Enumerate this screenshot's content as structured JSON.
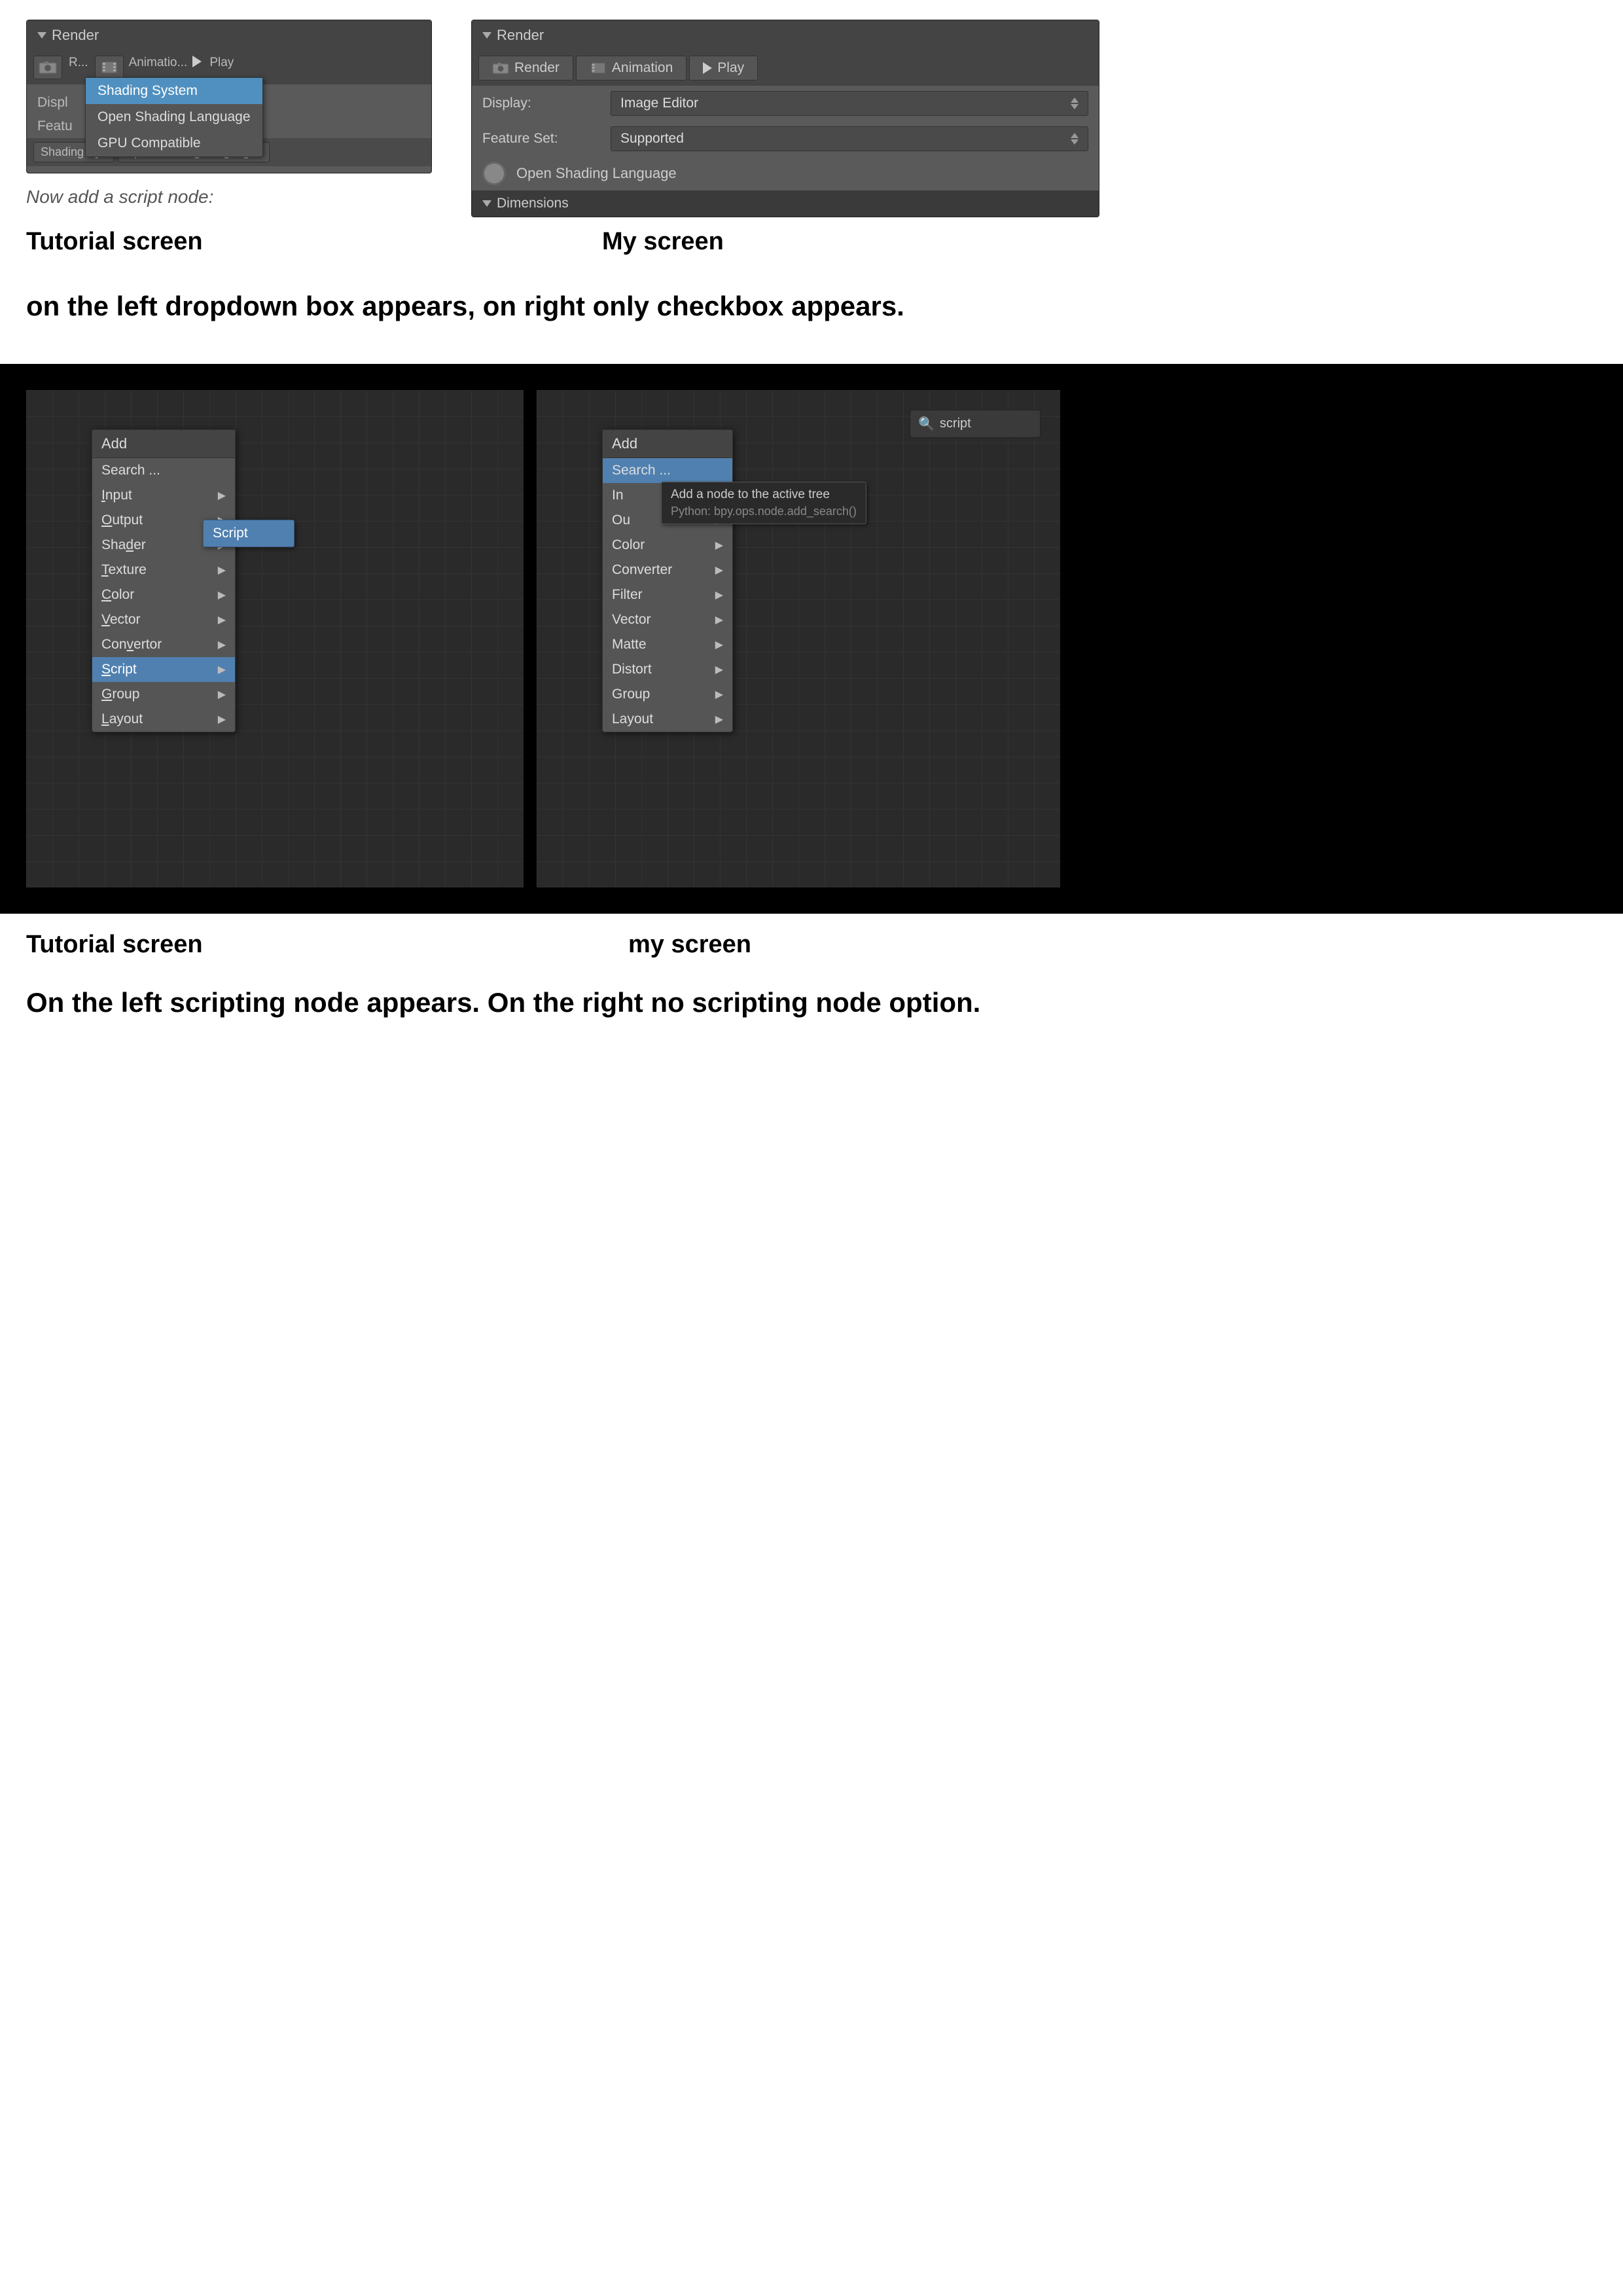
{
  "top": {
    "left_panel": {
      "header": "Render",
      "rows": [
        {
          "label": "Displ"
        },
        {
          "label": "Featu"
        },
        {
          "label": "Shading Sys"
        }
      ],
      "dropdown": {
        "items": [
          "Shading System",
          "Open Shading Language",
          "GPU Compatible"
        ],
        "active": 0
      },
      "bottom_buttons": [
        "Shading Sys",
        "Open Shading Languag▼"
      ]
    },
    "right_panel": {
      "header": "Render",
      "tabs": [
        "Render",
        "Animation",
        "Play"
      ],
      "display_label": "Display:",
      "display_value": "Image Editor",
      "feature_label": "Feature Set:",
      "feature_value": "Supported",
      "checkbox_label": "Open Shading Language",
      "dimensions_label": "Dimensions"
    },
    "caption_left": "Tutorial screen",
    "caption_right": "My screen",
    "description": "on the left dropdown box appears, on right only checkbox appears."
  },
  "bottom": {
    "left_panel": {
      "menu_header": "Add",
      "menu_items": [
        {
          "label": "Search ...",
          "has_arrow": false,
          "selected": false
        },
        {
          "label": "Input",
          "has_arrow": true,
          "selected": false
        },
        {
          "label": "Output",
          "has_arrow": true,
          "selected": false
        },
        {
          "label": "Shader",
          "has_arrow": true,
          "selected": false
        },
        {
          "label": "Texture",
          "has_arrow": true,
          "selected": false
        },
        {
          "label": "Color",
          "has_arrow": true,
          "selected": false
        },
        {
          "label": "Vector",
          "has_arrow": true,
          "selected": false
        },
        {
          "label": "Convertor",
          "has_arrow": true,
          "selected": false
        },
        {
          "label": "Script",
          "has_arrow": true,
          "selected": true
        },
        {
          "label": "Group",
          "has_arrow": true,
          "selected": false
        },
        {
          "label": "Layout",
          "has_arrow": true,
          "selected": false
        }
      ],
      "submenu_item": "Script"
    },
    "right_panel": {
      "menu_header": "Add",
      "menu_items": [
        {
          "label": "Search ...",
          "has_arrow": false,
          "selected": true
        },
        {
          "label": "In",
          "has_arrow": true,
          "selected": false
        },
        {
          "label": "Ou",
          "has_arrow": true,
          "selected": false
        },
        {
          "label": "Color",
          "has_arrow": true,
          "selected": false
        },
        {
          "label": "Converter",
          "has_arrow": true,
          "selected": false
        },
        {
          "label": "Filter",
          "has_arrow": true,
          "selected": false
        },
        {
          "label": "Vector",
          "has_arrow": true,
          "selected": false
        },
        {
          "label": "Matte",
          "has_arrow": true,
          "selected": false
        },
        {
          "label": "Distort",
          "has_arrow": true,
          "selected": false
        },
        {
          "label": "Group",
          "has_arrow": true,
          "selected": false
        },
        {
          "label": "Layout",
          "has_arrow": true,
          "selected": false
        }
      ],
      "tooltip_line1": "Add a node to the active tree",
      "tooltip_line2": "Python: bpy.ops.node.add_search()",
      "search_placeholder": "script"
    },
    "caption_left": "Tutorial screen",
    "caption_right": "my screen",
    "description": "On the left scripting node appears. On the right no scripting node option."
  }
}
